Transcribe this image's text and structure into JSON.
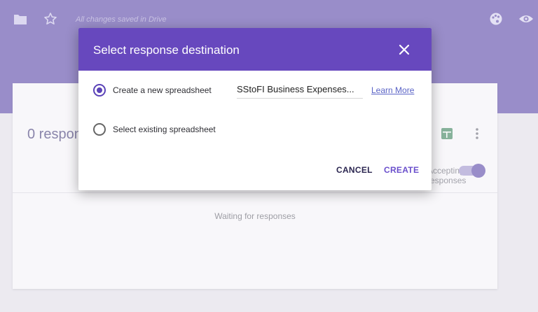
{
  "topbar": {
    "folder_icon": "folder-icon",
    "star_icon": "star-icon",
    "status": "All changes saved in Drive",
    "palette_icon": "palette-icon",
    "preview_icon": "eye-icon"
  },
  "responses": {
    "count_label": "0 responses",
    "accepting_label": "Accepting responses",
    "waiting": "Waiting for responses",
    "accepting_on": true
  },
  "dialog": {
    "title": "Select response destination",
    "options": [
      {
        "label": "Create a new spreadsheet",
        "checked": true
      },
      {
        "label": "Select existing spreadsheet",
        "checked": false
      }
    ],
    "spreadsheet_name": "SStoFI Business Expenses...",
    "learn_more": "Learn More",
    "cancel": "CANCEL",
    "create": "CREATE"
  },
  "colors": {
    "header_purple": "#4f3aa3",
    "dialog_header": "#6748be",
    "accent": "#5b43b8"
  }
}
